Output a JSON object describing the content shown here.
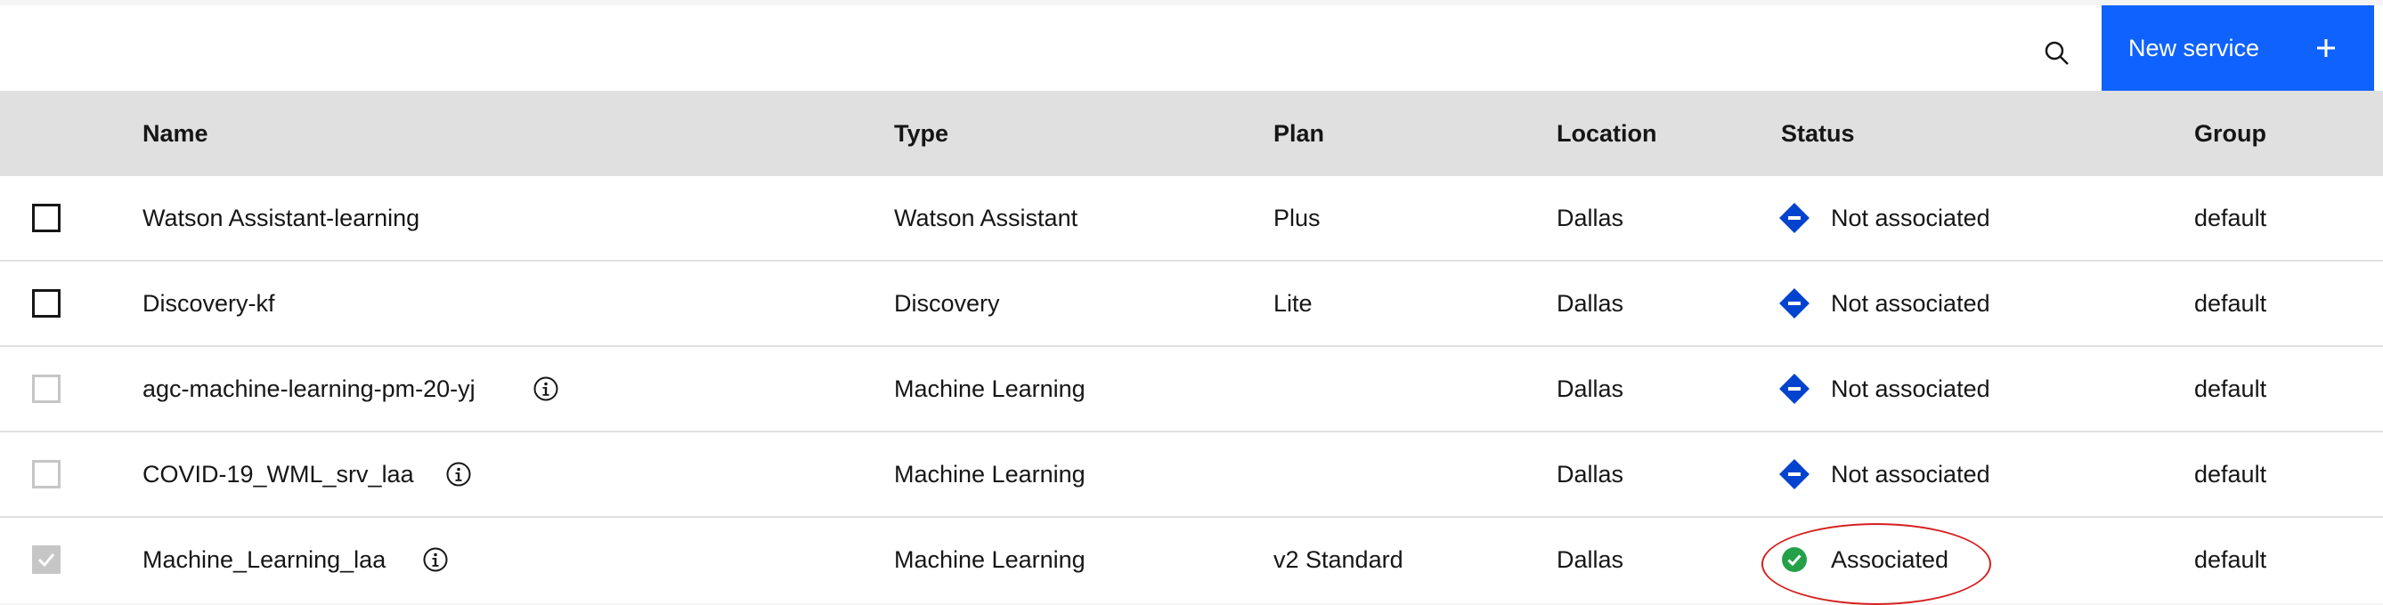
{
  "toolbar": {
    "search_icon": "search-icon",
    "new_service_label": "New service",
    "plus_icon": "plus-icon"
  },
  "columns": [
    "Name",
    "Type",
    "Plan",
    "Location",
    "Status",
    "Group"
  ],
  "rows": [
    {
      "name": "Watson Assistant-learning",
      "type": "Watson Assistant",
      "plan": "Plus",
      "location": "Dallas",
      "status": "Not associated",
      "group": "default",
      "checkbox": "unchecked",
      "info": false
    },
    {
      "name": "Discovery-kf",
      "type": "Discovery",
      "plan": "Lite",
      "location": "Dallas",
      "status": "Not associated",
      "group": "default",
      "checkbox": "unchecked",
      "info": false
    },
    {
      "name": "agc-machine-learning-pm-20-yj",
      "type": "Machine Learning",
      "plan": "",
      "location": "Dallas",
      "status": "Not associated",
      "group": "default",
      "checkbox": "disabled",
      "info": true
    },
    {
      "name": "COVID-19_WML_srv_laa",
      "type": "Machine Learning",
      "plan": "",
      "location": "Dallas",
      "status": "Not associated",
      "group": "default",
      "checkbox": "disabled",
      "info": true
    },
    {
      "name": "Machine_Learning_laa",
      "type": "Machine Learning",
      "plan": "v2 Standard",
      "location": "Dallas",
      "status": "Associated",
      "group": "default",
      "checkbox": "checked-disabled",
      "info": true
    }
  ],
  "colors": {
    "primary": "#0f62fe",
    "not_associated": "#0043ce",
    "associated": "#24a148",
    "annotation": "#d61f1f"
  }
}
